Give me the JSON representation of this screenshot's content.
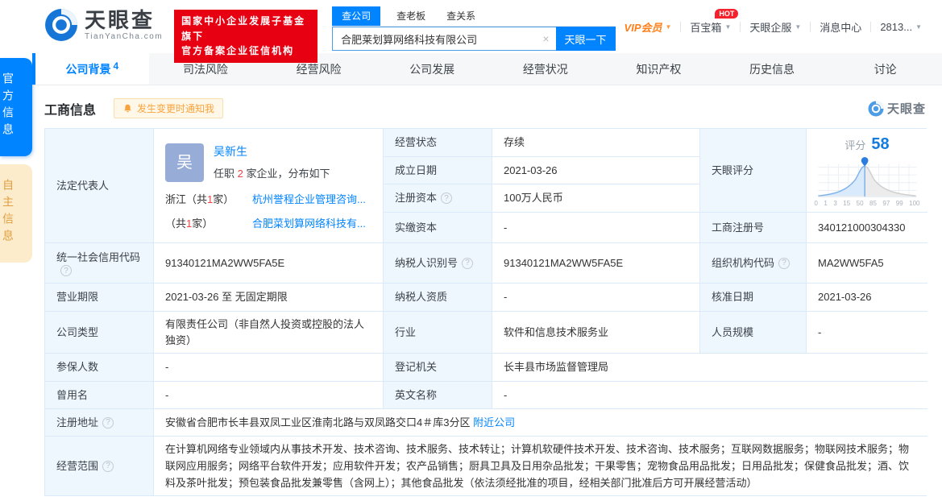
{
  "header": {
    "brand": {
      "name": "天眼查",
      "domain": "TianYanCha.com"
    },
    "badge": {
      "line1": "国家中小企业发展子基金旗下",
      "line2": "官方备案企业征信机构"
    },
    "search": {
      "tabs": [
        {
          "label": "查公司"
        },
        {
          "label": "查老板"
        },
        {
          "label": "查关系"
        }
      ],
      "value": "合肥莱划算网络科技有限公司",
      "clear_icon": "×",
      "button": "天眼一下"
    },
    "menu": {
      "vip": "VIP会员",
      "toolbox": "百宝箱",
      "hot_badge": "HOT",
      "enterprise": "天眼企服",
      "messages": "消息中心",
      "account": "2813...",
      "caret": "▼"
    }
  },
  "side_tabs": [
    {
      "label": "官方信息"
    },
    {
      "label": "自主信息"
    }
  ],
  "nav_tabs": [
    {
      "label": "公司背景",
      "count": "4"
    },
    {
      "label": "司法风险"
    },
    {
      "label": "经营风险"
    },
    {
      "label": "公司发展"
    },
    {
      "label": "经营状况"
    },
    {
      "label": "知识产权"
    },
    {
      "label": "历史信息"
    },
    {
      "label": "讨论"
    }
  ],
  "section": {
    "title": "工商信息",
    "notify": "发生变更时通知我",
    "watermark": "天眼查"
  },
  "colors": {
    "accent": "#0084ff",
    "badge_red": "#e60012",
    "orange": "#ff7f19",
    "label_bg": "#eef6fe",
    "border": "#dbeafb"
  },
  "legal_rep": {
    "label": "法定代表人",
    "avatar_char": "吴",
    "name": "吴新生",
    "tenure_prefix": "任职 ",
    "tenure_count": "2",
    "tenure_suffix": " 家企业，分布如下",
    "dist": [
      {
        "region_pre": "浙江（共",
        "count": "1",
        "region_post": "家）",
        "company": "杭州誉程企业管理咨询..."
      },
      {
        "region_pre": "（共",
        "count": "1",
        "region_post": "家）",
        "company": "合肥菜划算网络科技有..."
      }
    ]
  },
  "score": {
    "label": "天眼评分",
    "word": "评分",
    "value": "58",
    "xticks": [
      "0",
      "1",
      "3",
      "15",
      "50",
      "85",
      "97",
      "99",
      "100"
    ]
  },
  "fields": {
    "status": {
      "label": "经营状态",
      "value": "存续"
    },
    "est_date": {
      "label": "成立日期",
      "value": "2021-03-26"
    },
    "reg_capital": {
      "label": "注册资本",
      "value": "100万人民币"
    },
    "paid_capital": {
      "label": "实缴资本",
      "value": "-"
    },
    "reg_number": {
      "label": "工商注册号",
      "value": "340121000304330"
    },
    "credit_code": {
      "label": "统一社会信用代码",
      "value": "91340121MA2WW5FA5E"
    },
    "taxpayer_id": {
      "label": "纳税人识别号",
      "value": "91340121MA2WW5FA5E"
    },
    "org_code": {
      "label": "组织机构代码",
      "value": "MA2WW5FA5"
    },
    "biz_term": {
      "label": "营业期限",
      "value": "2021-03-26 至 无固定期限"
    },
    "taxpayer_quali": {
      "label": "纳税人资质",
      "value": "-"
    },
    "approval_date": {
      "label": "核准日期",
      "value": "2021-03-26"
    },
    "company_type": {
      "label": "公司类型",
      "value": "有限责任公司（非自然人投资或控股的法人独资）"
    },
    "industry": {
      "label": "行业",
      "value": "软件和信息技术服务业"
    },
    "staff_size": {
      "label": "人员规模",
      "value": "-"
    },
    "insured_count": {
      "label": "参保人数",
      "value": "-"
    },
    "reg_authority": {
      "label": "登记机关",
      "value": "长丰县市场监督管理局"
    },
    "former_name": {
      "label": "曾用名",
      "value": "-"
    },
    "english_name": {
      "label": "英文名称",
      "value": "-"
    },
    "address": {
      "label": "注册地址",
      "value": "安徽省合肥市长丰县双凤工业区淮南北路与双凤路交口4＃库3分区",
      "link": "附近公司"
    },
    "business_scope": {
      "label": "经营范围",
      "value": "在计算机网络专业领域内从事技术开发、技术咨询、技术服务、技术转让；计算机软硬件技术开发、技术咨询、技术服务；互联网数据服务；物联网技术服务；物联网应用服务；网络平台软件开发；应用软件开发；农产品销售；厨具卫具及日用杂品批发；干果零售；宠物食品用品批发；日用品批发；保健食品批发；酒、饮料及茶叶批发；预包装食品批发兼零售（含网上）；其他食品批发（依法须经批准的项目，经相关部门批准后方可开展经营活动）"
    }
  }
}
